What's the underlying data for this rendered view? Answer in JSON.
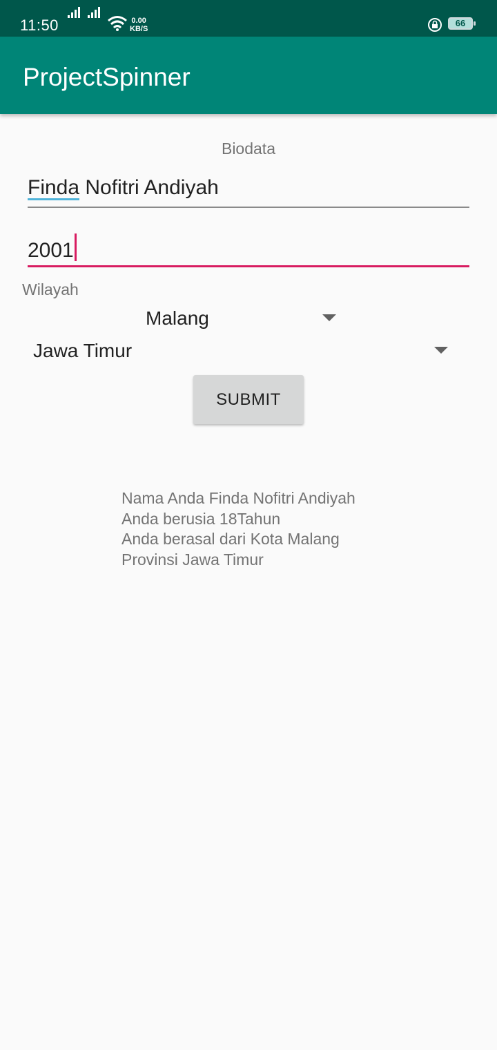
{
  "status_bar": {
    "time": "11:50",
    "net_speed_value": "0.00",
    "net_speed_unit": "KB/S",
    "battery": "66"
  },
  "app_bar": {
    "title": "ProjectSpinner"
  },
  "form": {
    "section_label": "Biodata",
    "name_value": "Finda Nofitri Andiyah",
    "name_misspelled_word": "Finda",
    "name_rest": " Nofitri Andiyah",
    "year_value": "2001",
    "region_label": "Wilayah",
    "city_selected": "Malang",
    "province_selected": "Jawa Timur",
    "submit_label": "SUBMIT"
  },
  "result": {
    "lines": [
      "Nama Anda Finda Nofitri Andiyah",
      "Anda berusia 18Tahun",
      "Anda berasal dari Kota Malang",
      "Provinsi Jawa Timur"
    ]
  },
  "colors": {
    "status_bar": "#00574b",
    "app_bar": "#008577",
    "accent": "#d81b60",
    "background": "#fafafa"
  }
}
